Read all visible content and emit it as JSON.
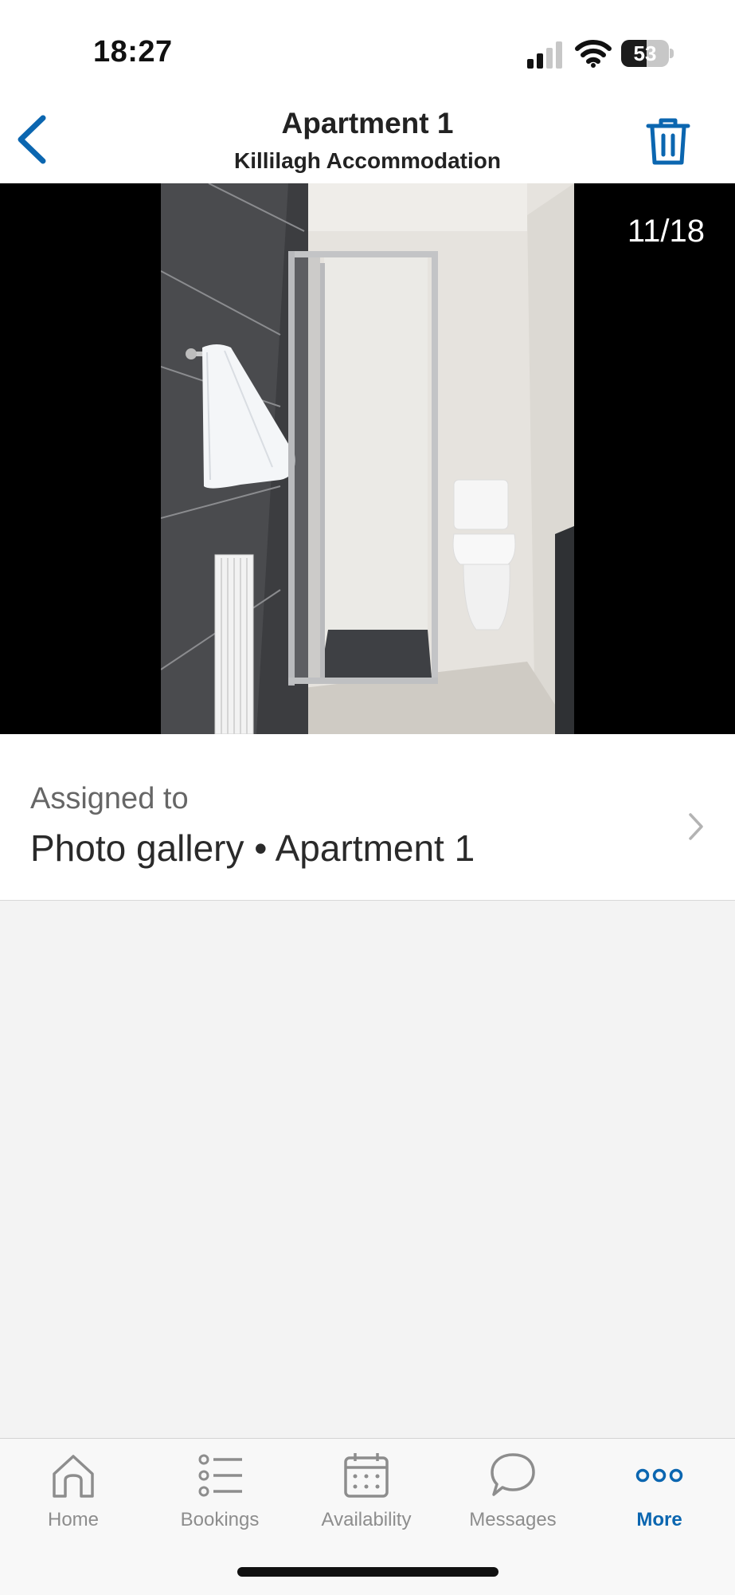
{
  "status_bar": {
    "time": "18:27",
    "battery_level": "53",
    "battery_fraction": 0.53,
    "icons": [
      "signal-icon",
      "wifi-icon",
      "battery-icon"
    ]
  },
  "header": {
    "title": "Apartment 1",
    "subtitle": "Killilagh Accommodation",
    "back_icon": "chevron-left-icon",
    "delete_icon": "trash-icon"
  },
  "photo": {
    "counter": "11/18",
    "description_icon": "bathroom-photo"
  },
  "assignment": {
    "label": "Assigned to",
    "value": "Photo gallery • Apartment 1",
    "chevron_icon": "chevron-right-icon"
  },
  "tabs": [
    {
      "label": "Home",
      "icon": "home-icon",
      "active": false
    },
    {
      "label": "Bookings",
      "icon": "list-icon",
      "active": false
    },
    {
      "label": "Availability",
      "icon": "calendar-icon",
      "active": false
    },
    {
      "label": "Messages",
      "icon": "chat-bubble-icon",
      "active": false
    },
    {
      "label": "More",
      "icon": "more-dots-icon",
      "active": true
    }
  ],
  "colors": {
    "accent": "#0b66b0",
    "inactive": "#8d8d8d",
    "background": "#f3f3f3"
  }
}
